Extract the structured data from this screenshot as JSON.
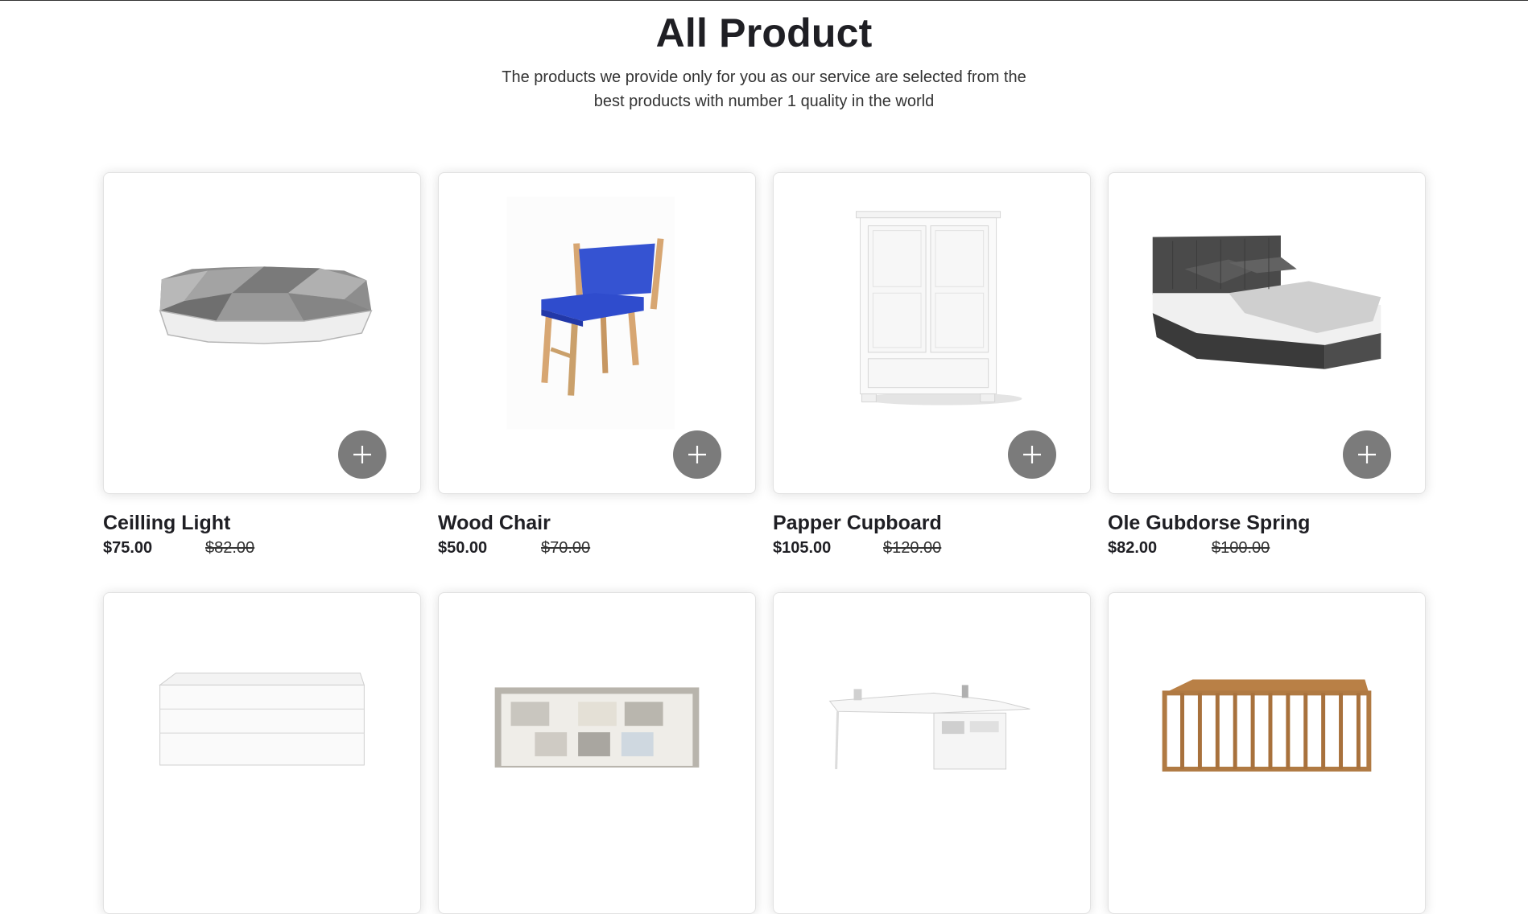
{
  "header": {
    "title": "All Product",
    "subtitle_line1": "The products we provide only for you as our service are selected from the",
    "subtitle_line2": "best products with number 1 quality in the world"
  },
  "products": [
    {
      "name": "Ceilling Light",
      "price": "$75.00",
      "old_price": "$82.00",
      "image": "ceiling-light"
    },
    {
      "name": "Wood Chair",
      "price": "$50.00",
      "old_price": "$70.00",
      "image": "wood-chair"
    },
    {
      "name": "Papper Cupboard",
      "price": "$105.00",
      "old_price": "$120.00",
      "image": "cupboard"
    },
    {
      "name": "Ole Gubdorse Spring",
      "price": "$82.00",
      "old_price": "$100.00",
      "image": "bed"
    },
    {
      "image": "drawer-chest"
    },
    {
      "image": "photo-frame"
    },
    {
      "image": "corner-desk"
    },
    {
      "image": "wooden-crib"
    }
  ],
  "colors": {
    "add_button": "#7b7b7b",
    "text": "#1f1f24"
  }
}
